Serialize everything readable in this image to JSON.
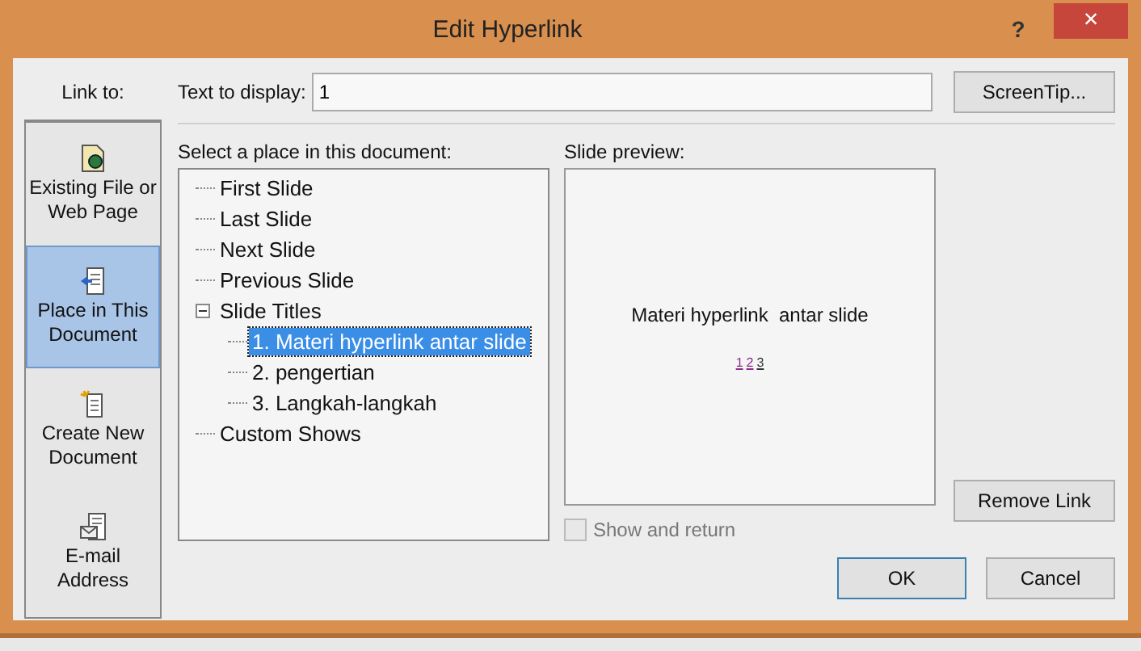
{
  "window": {
    "title": "Edit Hyperlink",
    "help": "?",
    "close": "×"
  },
  "link_to": {
    "label": "Link to:",
    "items": [
      {
        "label": "Existing File or Web Page",
        "kind": "file",
        "selected": false
      },
      {
        "label": "Place in This Document",
        "kind": "place",
        "selected": true
      },
      {
        "label": "Create New Document",
        "kind": "new",
        "selected": false
      },
      {
        "label": "E-mail Address",
        "kind": "email",
        "selected": false
      }
    ]
  },
  "text_to_display": {
    "label": "Text to display:",
    "value": "1"
  },
  "screentip_button": "ScreenTip...",
  "place_tree": {
    "label": "Select a place in this document:",
    "items": [
      {
        "label": "First Slide",
        "selected": false
      },
      {
        "label": "Last Slide",
        "selected": false
      },
      {
        "label": "Next Slide",
        "selected": false
      },
      {
        "label": "Previous Slide",
        "selected": false
      },
      {
        "label": "Slide Titles",
        "selected": false,
        "expanded": true,
        "children": [
          {
            "label": "1. Materi hyperlink antar slide",
            "selected": true
          },
          {
            "label": "2. pengertian",
            "selected": false
          },
          {
            "label": "3. Langkah-langkah",
            "selected": false
          }
        ]
      },
      {
        "label": "Custom Shows",
        "selected": false
      }
    ]
  },
  "slide_preview": {
    "label": "Slide preview:",
    "title": "Materi hyperlink  antar slide",
    "links": [
      {
        "text": "1",
        "visited": true
      },
      {
        "text": "2",
        "visited": true
      },
      {
        "text": "3",
        "visited": false
      }
    ]
  },
  "show_and_return": {
    "label": "Show and return",
    "checked": false,
    "disabled": true
  },
  "buttons": {
    "remove_link": "Remove Link",
    "ok": "OK",
    "cancel": "Cancel"
  }
}
